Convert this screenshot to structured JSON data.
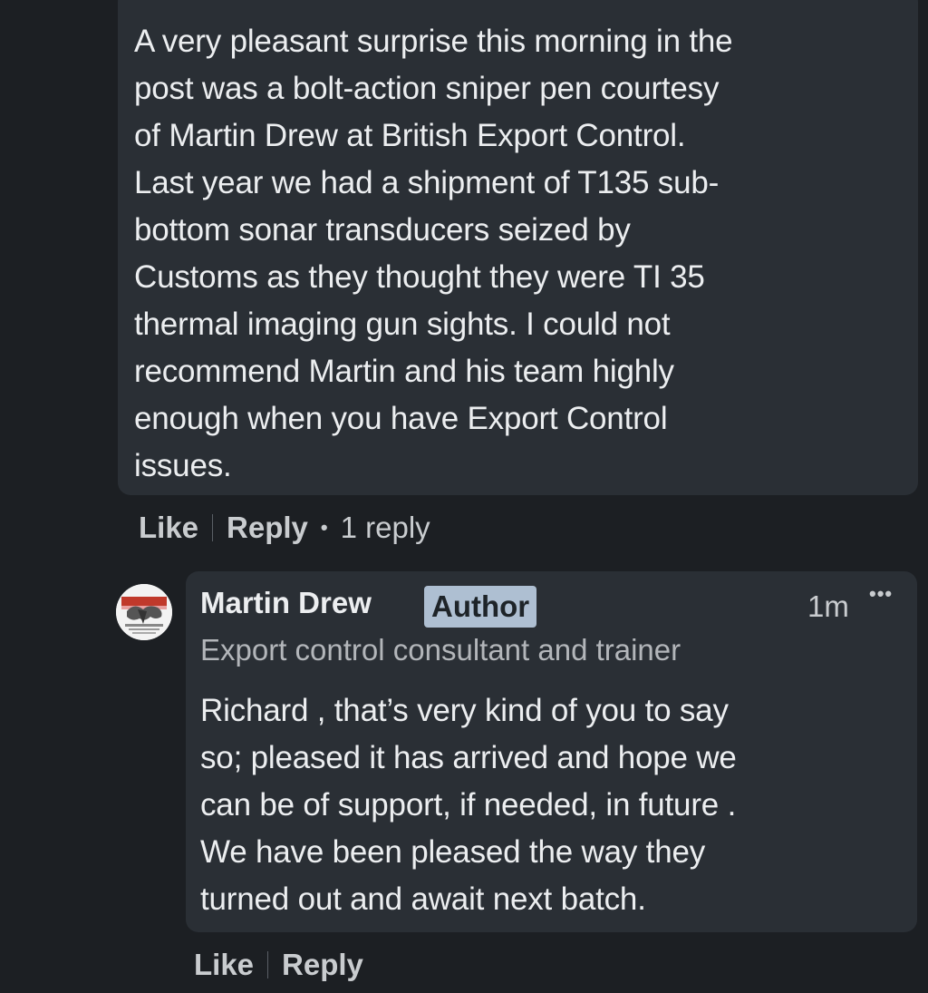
{
  "comment": {
    "text": "A very pleasant surprise this morning in the\npost was a bolt-action sniper pen courtesy\nof Martin Drew at British Export Control.\nLast year we had a shipment of T135 sub-\nbottom sonar transducers seized by\nCustoms as they thought they were TI 35\nthermal imaging gun sights. I could not\nrecommend Martin and his team highly\nenough when you have Export Control\nissues.",
    "like_label": "Like",
    "reply_label": "Reply",
    "reply_count": "1 reply"
  },
  "reply": {
    "author_name": "Martin Drew",
    "author_badge": "Author",
    "timestamp": "1m",
    "more_icon": "more-horizontal-icon",
    "headline": "Export control consultant and trainer",
    "text": "Richard , that’s  very kind of you to say\nso; pleased it has arrived  and hope we\ncan be of support, if needed, in future .\nWe have been pleased the way they\nturned out and await next batch.",
    "like_label": "Like",
    "reply_label": "Reply"
  },
  "colors": {
    "background": "#1c1f23",
    "bubble": "#2a2f35",
    "badge": "#aebfd2",
    "text": "#eceef0",
    "muted": "#c9cccf"
  }
}
